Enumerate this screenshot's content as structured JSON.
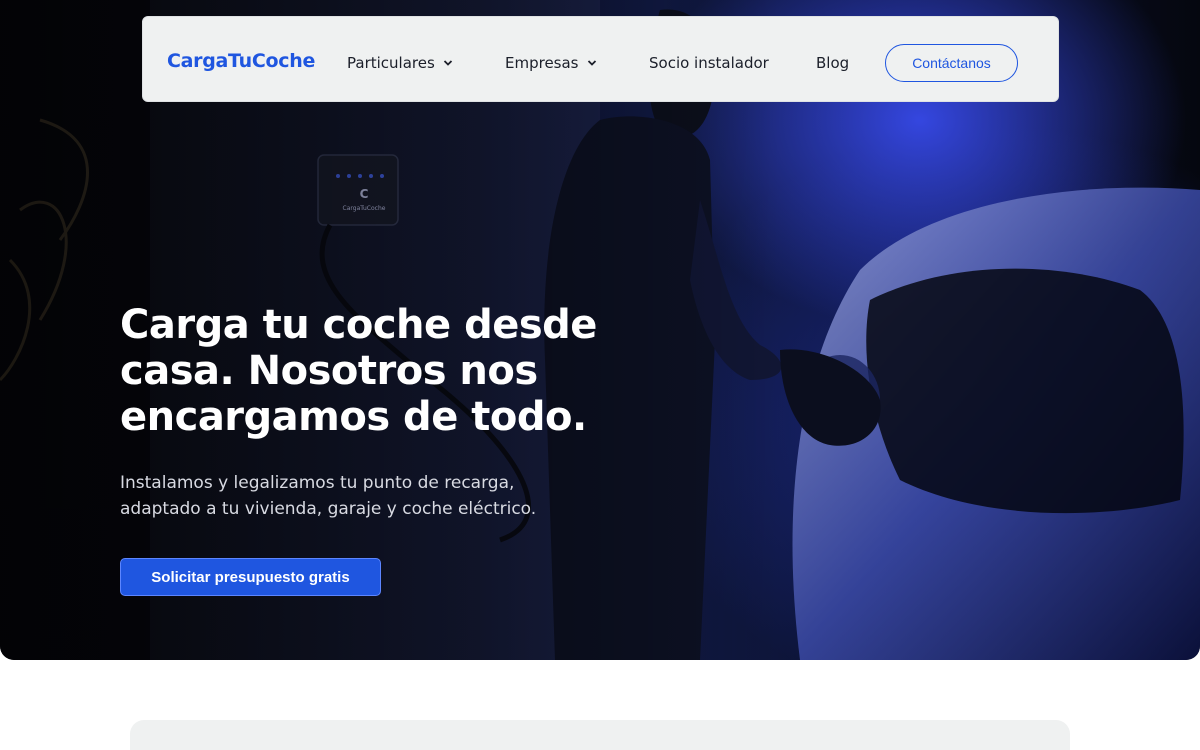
{
  "navbar": {
    "logo": "CargaTuCoche",
    "items": [
      {
        "label": "Particulares",
        "has_dropdown": true
      },
      {
        "label": "Empresas",
        "has_dropdown": true
      },
      {
        "label": "Socio instalador",
        "has_dropdown": false
      },
      {
        "label": "Blog",
        "has_dropdown": false
      }
    ],
    "contact_label": "Contáctanos"
  },
  "hero": {
    "title": "Carga tu coche desde casa. Nosotros nos encargamos de todo.",
    "subtitle": "Instalamos y legalizamos tu punto de recarga, adaptado a tu vivienda, garaje y coche eléctrico.",
    "cta_label": "Solicitar presupuesto gratis",
    "charger_brand": "CargaTuCoche"
  },
  "colors": {
    "accent": "#1f56e0",
    "navbar_bg": "#eff1f1",
    "hero_text": "#ffffff"
  }
}
